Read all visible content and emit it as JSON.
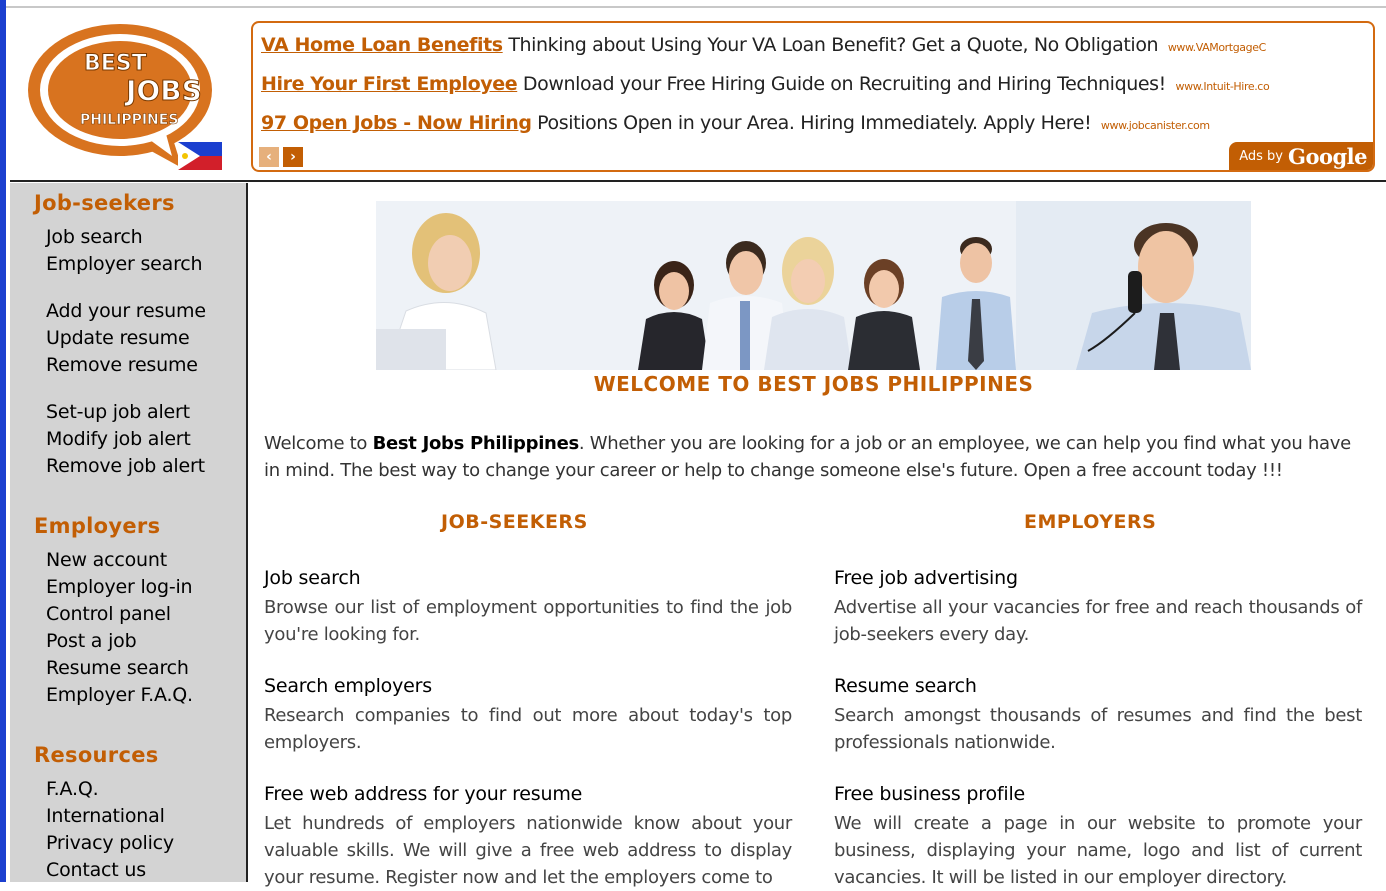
{
  "logo": {
    "line1": "BEST",
    "line2": "JOBS",
    "line3": "PHILIPPINES"
  },
  "ads": {
    "items": [
      {
        "title": "VA Home Loan Benefits",
        "text": "Thinking about Using Your VA Loan Benefit? Get a Quote, No Obligation",
        "url": "www.VAMortgageC"
      },
      {
        "title": "Hire Your First Employee",
        "text": "Download your Free Hiring Guide on Recruiting and Hiring Techniques!",
        "url": "www.Intuit-Hire.co"
      },
      {
        "title": "97 Open Jobs - Now Hiring",
        "text": "Positions Open in your Area. Hiring Immediately. Apply Here!",
        "url": "www.jobcanister.com"
      }
    ],
    "prev": "‹",
    "next": "›",
    "ads_by": "Ads by",
    "google": "Google"
  },
  "sidebar": {
    "jobseekers_head": "Job-seekers",
    "jobseekers": [
      "Job search",
      "Employer search",
      "Add your resume",
      "Update resume",
      "Remove resume",
      "Set-up job alert",
      "Modify job alert",
      "Remove job alert"
    ],
    "employers_head": "Employers",
    "employers": [
      "New account",
      "Employer log-in",
      "Control panel",
      "Post a job",
      "Resume search",
      "Employer F.A.Q."
    ],
    "resources_head": "Resources",
    "resources": [
      "F.A.Q.",
      "International",
      "Privacy policy",
      "Contact us"
    ]
  },
  "main": {
    "welcome_title": "WELCOME TO BEST JOBS PHILIPPINES",
    "intro_pre": "Welcome to ",
    "intro_brand": "Best Jobs Philippines",
    "intro_post": ". Whether you are looking for a job or an employee, we can help you find what you have in mind. The best way to change your career or help to change someone else's future. Open a free account today !!!",
    "jobseekers_head": "JOB-SEEKERS",
    "employers_head": "EMPLOYERS",
    "jobseeker_features": [
      {
        "title": "Job search",
        "desc": "Browse our list of employment opportunities to find the job you're looking for."
      },
      {
        "title": "Search employers",
        "desc": "Research companies to find out more about today's top employers."
      },
      {
        "title": "Free web address for your resume",
        "desc": "Let hundreds of employers nationwide know about your valuable skills. We will give a free web address to display your resume. Register now and let the employers come to"
      }
    ],
    "employer_features": [
      {
        "title": "Free job advertising",
        "desc": "Advertise all your vacancies for free and reach thousands of job-seekers every day."
      },
      {
        "title": "Resume search",
        "desc": "Search amongst thousands of resumes and find the best professionals nationwide."
      },
      {
        "title": "Free business profile",
        "desc": "We will create a page in our website to promote your business, displaying your name, logo and list of current vacancies. It will be listed in our employer directory."
      }
    ]
  },
  "colors": {
    "accent": "#c25e04",
    "sidebar_bg": "#d3d3d3",
    "left_bar": "#1b3fcf"
  }
}
